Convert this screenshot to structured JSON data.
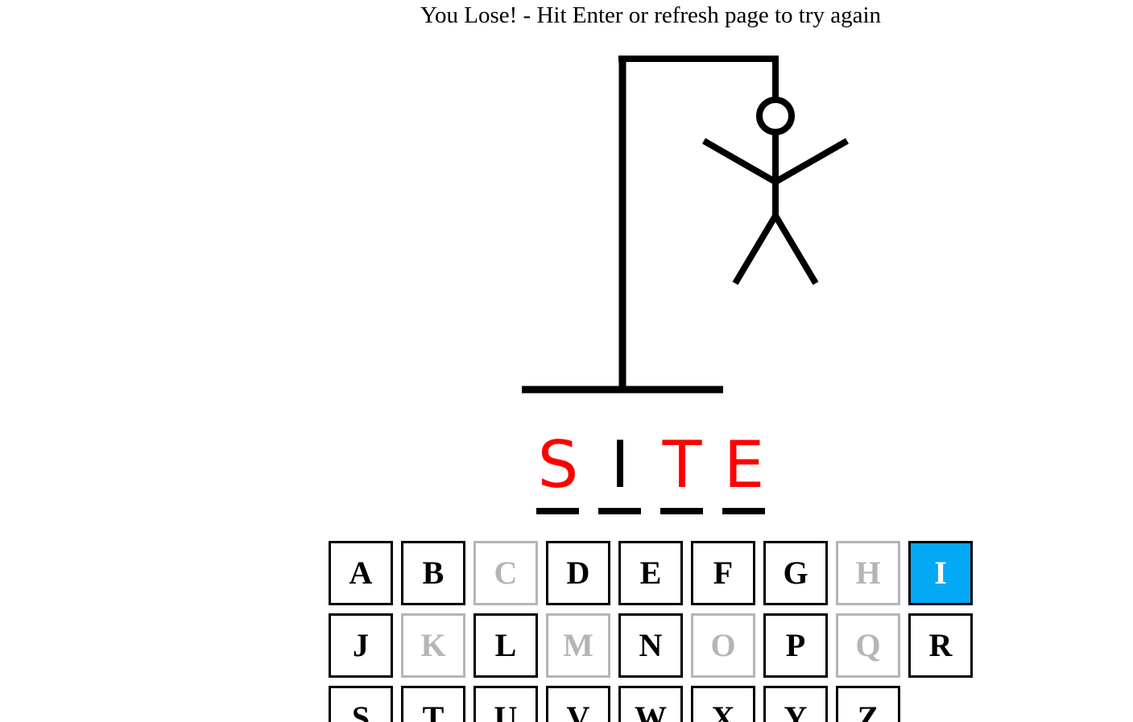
{
  "game": {
    "status_message": "You Lose! - Hit Enter or refresh page to try again"
  },
  "hangman": {
    "parts_drawn": [
      "base",
      "pole",
      "beam",
      "rope",
      "head",
      "body",
      "left-arm",
      "right-arm",
      "left-leg",
      "right-leg"
    ]
  },
  "word": {
    "letters": [
      {
        "char": "S",
        "state": "missed",
        "color": "#ff0000"
      },
      {
        "char": "I",
        "state": "found",
        "color": "#000000"
      },
      {
        "char": "T",
        "state": "missed",
        "color": "#ff0000"
      },
      {
        "char": "E",
        "state": "missed",
        "color": "#ff0000"
      }
    ]
  },
  "keyboard": {
    "selected_color": "#03a9f4",
    "used_color": "#b5b5b5",
    "keys": [
      {
        "letter": "A",
        "state": "available"
      },
      {
        "letter": "B",
        "state": "available"
      },
      {
        "letter": "C",
        "state": "used"
      },
      {
        "letter": "D",
        "state": "available"
      },
      {
        "letter": "E",
        "state": "available"
      },
      {
        "letter": "F",
        "state": "available"
      },
      {
        "letter": "G",
        "state": "available"
      },
      {
        "letter": "H",
        "state": "used"
      },
      {
        "letter": "I",
        "state": "selected"
      },
      {
        "letter": "J",
        "state": "available"
      },
      {
        "letter": "K",
        "state": "used"
      },
      {
        "letter": "L",
        "state": "available"
      },
      {
        "letter": "M",
        "state": "used"
      },
      {
        "letter": "N",
        "state": "available"
      },
      {
        "letter": "O",
        "state": "used"
      },
      {
        "letter": "P",
        "state": "available"
      },
      {
        "letter": "Q",
        "state": "used"
      },
      {
        "letter": "R",
        "state": "available"
      },
      {
        "letter": "S",
        "state": "available"
      },
      {
        "letter": "T",
        "state": "available"
      },
      {
        "letter": "U",
        "state": "available"
      },
      {
        "letter": "V",
        "state": "available"
      },
      {
        "letter": "W",
        "state": "available"
      },
      {
        "letter": "X",
        "state": "available"
      },
      {
        "letter": "Y",
        "state": "available"
      },
      {
        "letter": "Z",
        "state": "available"
      }
    ]
  }
}
